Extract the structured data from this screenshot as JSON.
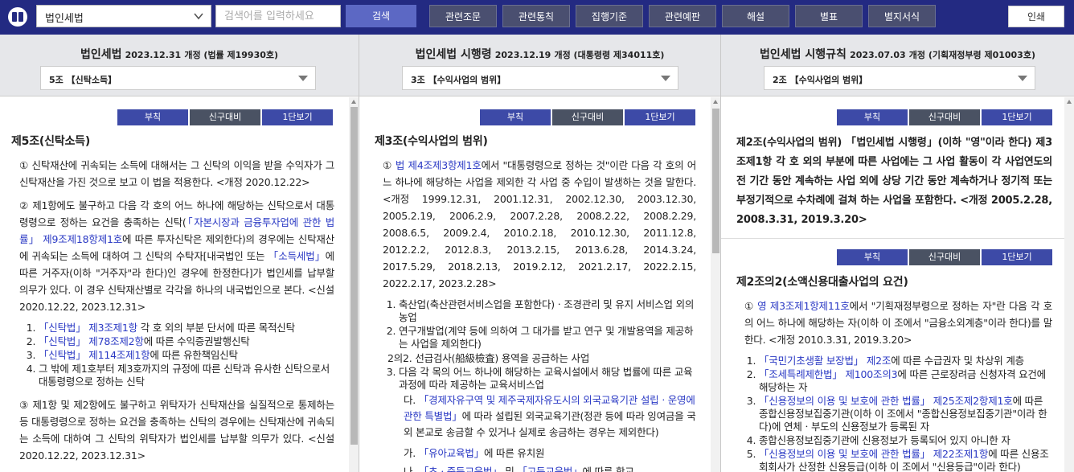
{
  "topbar": {
    "law_select": "법인세법",
    "search_placeholder": "검색어를 입력하세요",
    "search_button": "검색",
    "nav": [
      "관련조문",
      "관련통칙",
      "집행기준",
      "관련예판",
      "해설",
      "별표",
      "별지서식"
    ],
    "print": "인쇄"
  },
  "columns": [
    {
      "title": "법인세법",
      "date": "2023.12.31",
      "rev": "개정 (법률 제19930호)",
      "article_select": "5조 【신탁소득】",
      "buttons": [
        "부칙",
        "신구대비",
        "1단보기"
      ],
      "heading": "제5조(신탁소득)",
      "p1": "① 신탁재산에 귀속되는 소득에 대해서는 그 신탁의 이익을 받을 수익자가 그 신탁재산을 가진 것으로 보고 이 법을 적용한다. <개정 2020.12.22>",
      "p2a": "② 제1항에도 불구하고 다음 각 호의 어느 하나에 해당하는 신탁으로서 대통령령으로 정하는 요건을 충족하는 신탁(",
      "p2l1": "「자본시장과 금융투자업에 관한 법률」 제9조제18항제1호",
      "p2b": "에 따른 투자신탁은 제외한다)의 경우에는 신탁재산에 귀속되는 소득에 대하여 그 신탁의 수탁자[내국법인 또는 ",
      "p2l2": "「소득세법」",
      "p2c": "에 따른 거주자(이하 \"거주자\"라 한다)인 경우에 한정한다]가 법인세를 납부할 의무가 있다. 이 경우 신탁재산별로 각각을 하나의 내국법인으로 본다. <신설 2020.12.22, 2023.12.31>",
      "items": [
        {
          "link": "「신탁법」 제3조제1항",
          "text": " 각 호 외의 부분 단서에 따른 목적신탁"
        },
        {
          "link": "「신탁법」 제78조제2항",
          "text": "에 따른 수익증권발행신탁"
        },
        {
          "link": "「신탁법」 제114조제1항",
          "text": "에 따른 유한책임신탁"
        },
        {
          "link": "",
          "text": "그 밖에 제1호부터 제3호까지의 규정에 따른 신탁과 유사한 신탁으로서 대통령령으로 정하는 신탁"
        }
      ],
      "p3": "③ 제1항 및 제2항에도 불구하고 위탁자가 신탁재산을 실질적으로 통제하는 등 대통령령으로 정하는 요건을 충족하는 신탁의 경우에는 신탁재산에 귀속되는 소득에 대하여 그 신탁의 위탁자가 법인세를 납부할 의무가 있다. <신설 2020.12.22, 2023.12.31>"
    },
    {
      "title": "법인세법 시행령",
      "date": "2023.12.19",
      "rev": "개정 (대통령령 제34011호)",
      "article_select": "3조 【수익사업의 범위】",
      "buttons": [
        "부칙",
        "신구대비",
        "1단보기"
      ],
      "heading": "제3조(수익사업의 범위)",
      "p1a": "① ",
      "p1l": "법 제4조제3항제1호",
      "p1b": "에서 \"대통령령으로 정하는 것\"이란 다음 각 호의 어느 하나에 해당하는 사업을 제외한 각 사업 중 수입이 발생하는 것을 말한다. <개정 1999.12.31, 2001.12.31, 2002.12.30, 2003.12.30, 2005.2.19, 2006.2.9, 2007.2.28, 2008.2.22, 2008.2.29, 2008.6.5, 2009.2.4, 2010.2.18, 2010.12.30, 2011.12.8, 2012.2.2, 2012.8.3, 2013.2.15, 2013.6.28, 2014.3.24, 2017.5.29, 2018.2.13, 2019.2.12, 2021.2.17, 2022.2.15, 2022.2.17, 2023.2.28>",
      "items": [
        "축산업(축산관련서비스업을 포함한다)ㆍ조경관리 및 유지 서비스업 외의 농업",
        "연구개발업(계약 등에 의하여 그 대가를 받고 연구 및 개발용역을 제공하는 사업을 제외한다)"
      ],
      "item2of2": "2의2. 선급검사(船級檢査) 용역을 공급하는 사업",
      "item3": "다음 각 목의 어느 하나에 해당하는 교육시설에서 해당 법률에 따른 교육과정에 따라 제공하는 교육서비스업",
      "da_prefix": "다. ",
      "da_link": "「경제자유구역 및 제주국제자유도시의 외국교육기관 설립ㆍ운영에 관한 특별법」",
      "da_text": "에 따라 설립된 외국교육기관(정관 등에 따라 잉여금을 국외 본교로 송금할 수 있거나 실제로 송금하는 경우는 제외한다)",
      "ga_prefix": "가. ",
      "ga_link": "「유아교육법」",
      "ga_text": "에 따른 유치원",
      "na_prefix": "나. ",
      "na_link1": "「초ㆍ중등교육법」",
      "na_mid": " 및 ",
      "na_link2": "「고등교육법」",
      "na_text": "에 따른 학교"
    },
    {
      "title": "법인세법 시행규칙",
      "date": "2023.07.03",
      "rev": "개정 (기획재정부령 제01003호)",
      "article_select": "2조 【수익사업의 범위】",
      "buttons": [
        "부칙",
        "신구대비",
        "1단보기"
      ],
      "art1": "제2조(수익사업의 범위) 「법인세법 시행령」(이하 \"영\"이라 한다) 제3조제1항 각 호 외의 부분에 따른 사업에는 그 사업 활동이 각 사업연도의 전 기간 동안 계속하는 사업 외에 상당 기간 동안 계속하거나 정기적 또는 부정기적으로 수차례에 걸쳐 하는 사업을 포함한다. <개정 2005.2.28, 2008.3.31, 2019.3.20>",
      "buttons2": [
        "부칙",
        "신구대비",
        "1단보기"
      ],
      "heading2": "제2조의2(소액신용대출사업의 요건)",
      "p1a": "① ",
      "p1l": "영 제3조제1항제11호",
      "p1b": "에서 \"기획재정부령으로 정하는 자\"란 다음 각 호의 어느 하나에 해당하는 자(이하 이 조에서 \"금융소외계층\"이라 한다)를 말한다. <개정 2010.3.31, 2019.3.20>",
      "items": [
        {
          "link": "「국민기초생활 보장법」 제2조",
          "text": "에 따른 수급권자 및 차상위 계층"
        },
        {
          "link": "「조세특례제한법」 제100조의3",
          "text": "에 따른 근로장려금 신청자격 요건에 해당하는 자"
        },
        {
          "link": "「신용정보의 이용 및 보호에 관한 법률」 제25조제2항제1호",
          "text": "에 따른 종합신용정보집중기관(이하 이 조에서 \"종합신용정보집중기관\"이라 한다)에 연체ㆍ부도의 신용정보가 등록된 자"
        },
        {
          "link": "",
          "text": "종합신용정보집중기관에 신용정보가 등록되어 있지 아니한 자"
        },
        {
          "link": "「신용정보의 이용 및 보호에 관한 법률」 제22조제1항",
          "text": "에 따른 신용조회회사가 산정한 신용등급(이하 이 조에서 \"신용등급\"이라 한다)"
        }
      ]
    }
  ]
}
